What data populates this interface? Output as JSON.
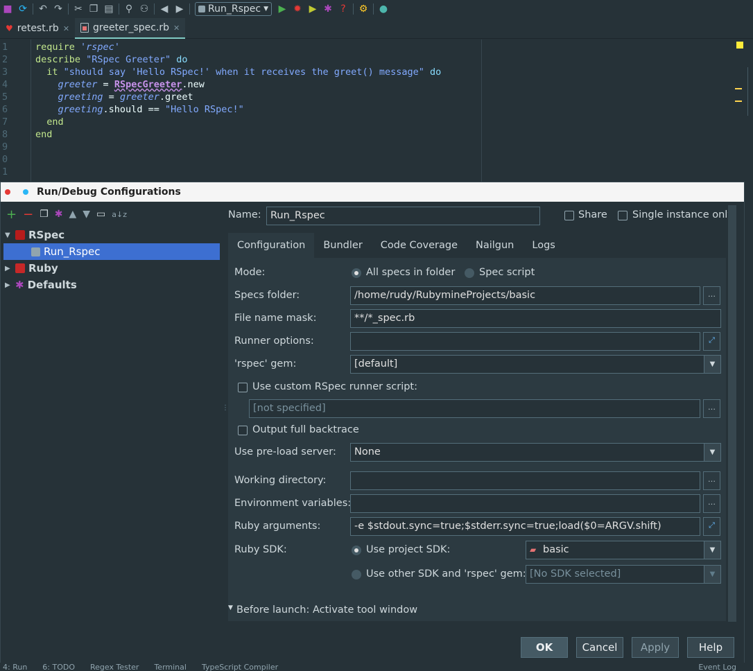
{
  "toolbar": {
    "run_config": "Run_Rspec",
    "icons": [
      "save-icon",
      "sync-icon",
      "undo-icon",
      "redo-icon",
      "cut-icon",
      "copy-icon",
      "paste-icon",
      "find-icon",
      "replace-icon",
      "back-icon",
      "forward-icon",
      "run-icon",
      "debug-icon",
      "coverage-icon",
      "settings-icon",
      "help-icon",
      "sdk-icon",
      "terminal-icon"
    ]
  },
  "tabs": [
    {
      "label": "retest.rb",
      "active": false
    },
    {
      "label": "greeter_spec.rb",
      "active": true
    }
  ],
  "editor": {
    "line_numbers": [
      "1",
      "2",
      "3",
      "4",
      "5",
      "6",
      "7",
      "8",
      "9",
      "0",
      "1"
    ],
    "lines": [
      "require 'rspec'",
      "describe \"RSpec Greeter\" do",
      "  it \"should say 'Hello RSpec!' when it receives the greet() message\" do",
      "    greeter = RSpecGreeter.new",
      "    greeting = greeter.greet",
      "    greeting.should == \"Hello RSpec!\"",
      "  end",
      "end"
    ]
  },
  "dialog": {
    "title": "Run/Debug Configurations",
    "tree": [
      {
        "label": "RSpec",
        "expanded": true
      },
      {
        "label": "Run_Rspec",
        "selected": true
      },
      {
        "label": "Ruby",
        "expanded": false
      },
      {
        "label": "Defaults",
        "expanded": false
      }
    ],
    "name_label": "Name:",
    "name_value": "Run_Rspec",
    "share_label": "Share",
    "single_instance_label": "Single instance only",
    "tabs": [
      "Configuration",
      "Bundler",
      "Code Coverage",
      "Nailgun",
      "Logs"
    ],
    "active_tab": "Configuration",
    "form": {
      "mode_label": "Mode:",
      "mode_all": "All specs in folder",
      "mode_script": "Spec script",
      "specs_folder_label": "Specs folder:",
      "specs_folder_value": "/home/rudy/RubymineProjects/basic",
      "file_mask_label": "File name mask:",
      "file_mask_value": "**/*_spec.rb",
      "runner_options_label": "Runner options:",
      "runner_options_value": "",
      "gem_label": "'rspec' gem:",
      "gem_value": "[default]",
      "custom_runner_label": "Use custom RSpec runner script:",
      "custom_runner_value": "[not specified]",
      "backtrace_label": "Output full backtrace",
      "preload_label": "Use pre-load server:",
      "preload_value": "None",
      "workdir_label": "Working directory:",
      "workdir_value": "",
      "env_label": "Environment variables:",
      "env_value": "",
      "ruby_args_label": "Ruby arguments:",
      "ruby_args_value": "-e $stdout.sync=true;$stderr.sync=true;load($0=ARGV.shift)",
      "ruby_sdk_label": "Ruby SDK:",
      "use_project_sdk": "Use project SDK:",
      "project_sdk_value": "basic",
      "use_other_sdk": "Use other SDK and 'rspec' gem:",
      "other_sdk_value": "[No SDK selected]",
      "before_launch": "Before launch: Activate tool window"
    },
    "buttons": {
      "ok": "OK",
      "cancel": "Cancel",
      "apply": "Apply",
      "help": "Help"
    }
  },
  "statusbar": {
    "items": [
      "4: Run",
      "6: TODO",
      "Regex Tester",
      "Terminal",
      "TypeScript Compiler"
    ],
    "right": "Event Log"
  },
  "colors": {
    "accent": "#3d6fd1",
    "background": "#263238",
    "run_green": "#4caf50",
    "debug_red": "#e53935"
  }
}
